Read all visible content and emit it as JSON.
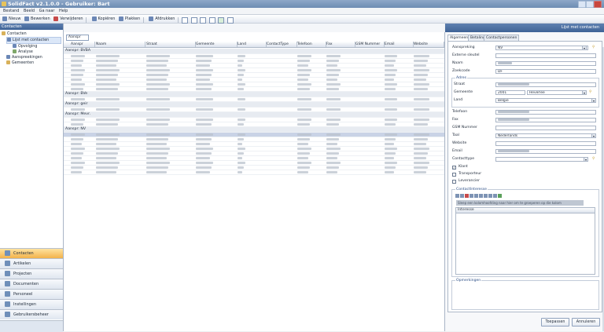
{
  "window": {
    "title": "SolidFact v2.1.0.0 - Gebruiker: Bart"
  },
  "menu": [
    "Bestand",
    "Beeld",
    "Ga naar",
    "Help"
  ],
  "toolbar": {
    "items": [
      {
        "label": "Nieuw",
        "icon": "new-icon"
      },
      {
        "label": "Bewerken",
        "icon": "edit-icon"
      },
      {
        "label": "Verwijderen",
        "icon": "delete-icon"
      },
      {
        "label": "Kopiëren",
        "icon": "copy-icon"
      },
      {
        "label": "Plakken",
        "icon": "paste-icon"
      },
      {
        "label": "Afdrukken",
        "icon": "print-icon"
      }
    ]
  },
  "left": {
    "header": "Contacten",
    "tree": [
      {
        "label": "Contacten",
        "level": 0
      },
      {
        "label": "Lijst met contacten",
        "level": 1,
        "selected": true
      },
      {
        "label": "Opvolging",
        "level": 2
      },
      {
        "label": "Analyse",
        "level": 2
      },
      {
        "label": "Aanspreekingen",
        "level": 1
      },
      {
        "label": "Gemeenten",
        "level": 1
      }
    ],
    "nav": [
      {
        "label": "Contacten",
        "active": true
      },
      {
        "label": "Artikelen"
      },
      {
        "label": "Projecten"
      },
      {
        "label": "Documenten"
      },
      {
        "label": "Personeel"
      },
      {
        "label": "Instellingen"
      },
      {
        "label": "Gebruikersbeheer"
      }
    ]
  },
  "grid": {
    "group_button": "Aanspr",
    "columns": [
      "Aanspr",
      "Naam",
      "Straat",
      "Gemeente",
      "Land",
      "ContactType",
      "Telefoon",
      "Fax",
      "GSM Nummer",
      "Email",
      "Website"
    ],
    "groups": [
      {
        "label": "Aanspr: BVBA",
        "rows": 8
      },
      {
        "label": "Aanspr: BVe",
        "rows": 1
      },
      {
        "label": "Aanspr: geir",
        "rows": 1
      },
      {
        "label": "Aanspr: Mevr.",
        "rows": 2
      },
      {
        "label": "Aanspr: NV",
        "rows": 9
      }
    ]
  },
  "right": {
    "header": "Lijst met contacten",
    "tabs": [
      "Algemeen",
      "Betaling",
      "Contactpersonen"
    ],
    "fields": {
      "aanspreking_label": "Aanspreking",
      "aanspreking_value": "NV",
      "externe_sleutel_label": "Externe sleutel",
      "naam_label": "Naam",
      "zoekcode_label": "Zoekcode",
      "zoekcode_value": "DF",
      "adres_label": "Adres",
      "straat_label": "Straat",
      "gemeente_label": "Gemeente",
      "postcode_value": "2001",
      "gemeente_value": "Heverlee",
      "land_label": "Land",
      "land_value": "Belgie",
      "telefoon_label": "Telefoon",
      "fax_label": "Fax",
      "gsm_label": "GSM Nummer",
      "taal_label": "Taal",
      "taal_value": "Nederlands",
      "website_label": "Website",
      "email_label": "Email",
      "contacttype_label": "Contacttype",
      "klant_label": "Klant",
      "transporteur_label": "Transporteur",
      "leverancier_label": "Leverancier",
      "contactinteresse_label": "ContactInteresse",
      "group_hint": "Sleep een kolomhoofding naar hier om te groeperen op die kolom",
      "interesse_col": "Interesse",
      "opmerkingen_label": "Opmerkingen"
    },
    "buttons": {
      "apply": "Toepassen",
      "cancel": "Annuleren"
    }
  }
}
